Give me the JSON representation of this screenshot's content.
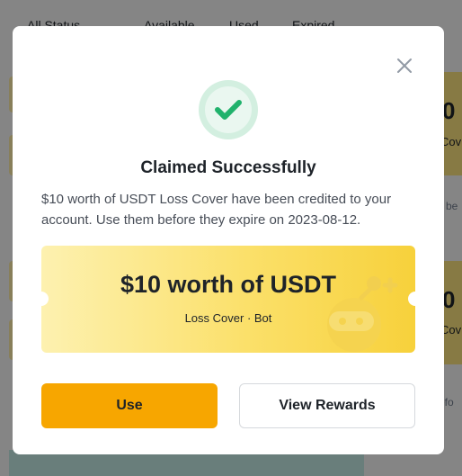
{
  "background": {
    "tabs": [
      "All Status",
      "Available",
      "Used",
      "Expired"
    ],
    "right_big": [
      "0",
      "0"
    ],
    "right_small": [
      "Cov",
      "Cov"
    ],
    "right_gray": [
      "n be",
      "efo"
    ]
  },
  "modal": {
    "close_icon": "close-icon",
    "status_icon": "check-circle-icon",
    "title": "Claimed Successfully",
    "description": "$10 worth of USDT Loss Cover have been credited to your account. Use them before they expire on 2023-08-12.",
    "voucher": {
      "title": "$10 worth of USDT",
      "subtitle": "Loss Cover · Bot",
      "decoration_icon": "robot-icon"
    },
    "buttons": {
      "use_label": "Use",
      "view_rewards_label": "View Rewards"
    }
  },
  "colors": {
    "accent": "#f7a600",
    "success": "#20b26c",
    "voucher_gradient": [
      "#fdf1b0",
      "#f7d13b"
    ]
  }
}
